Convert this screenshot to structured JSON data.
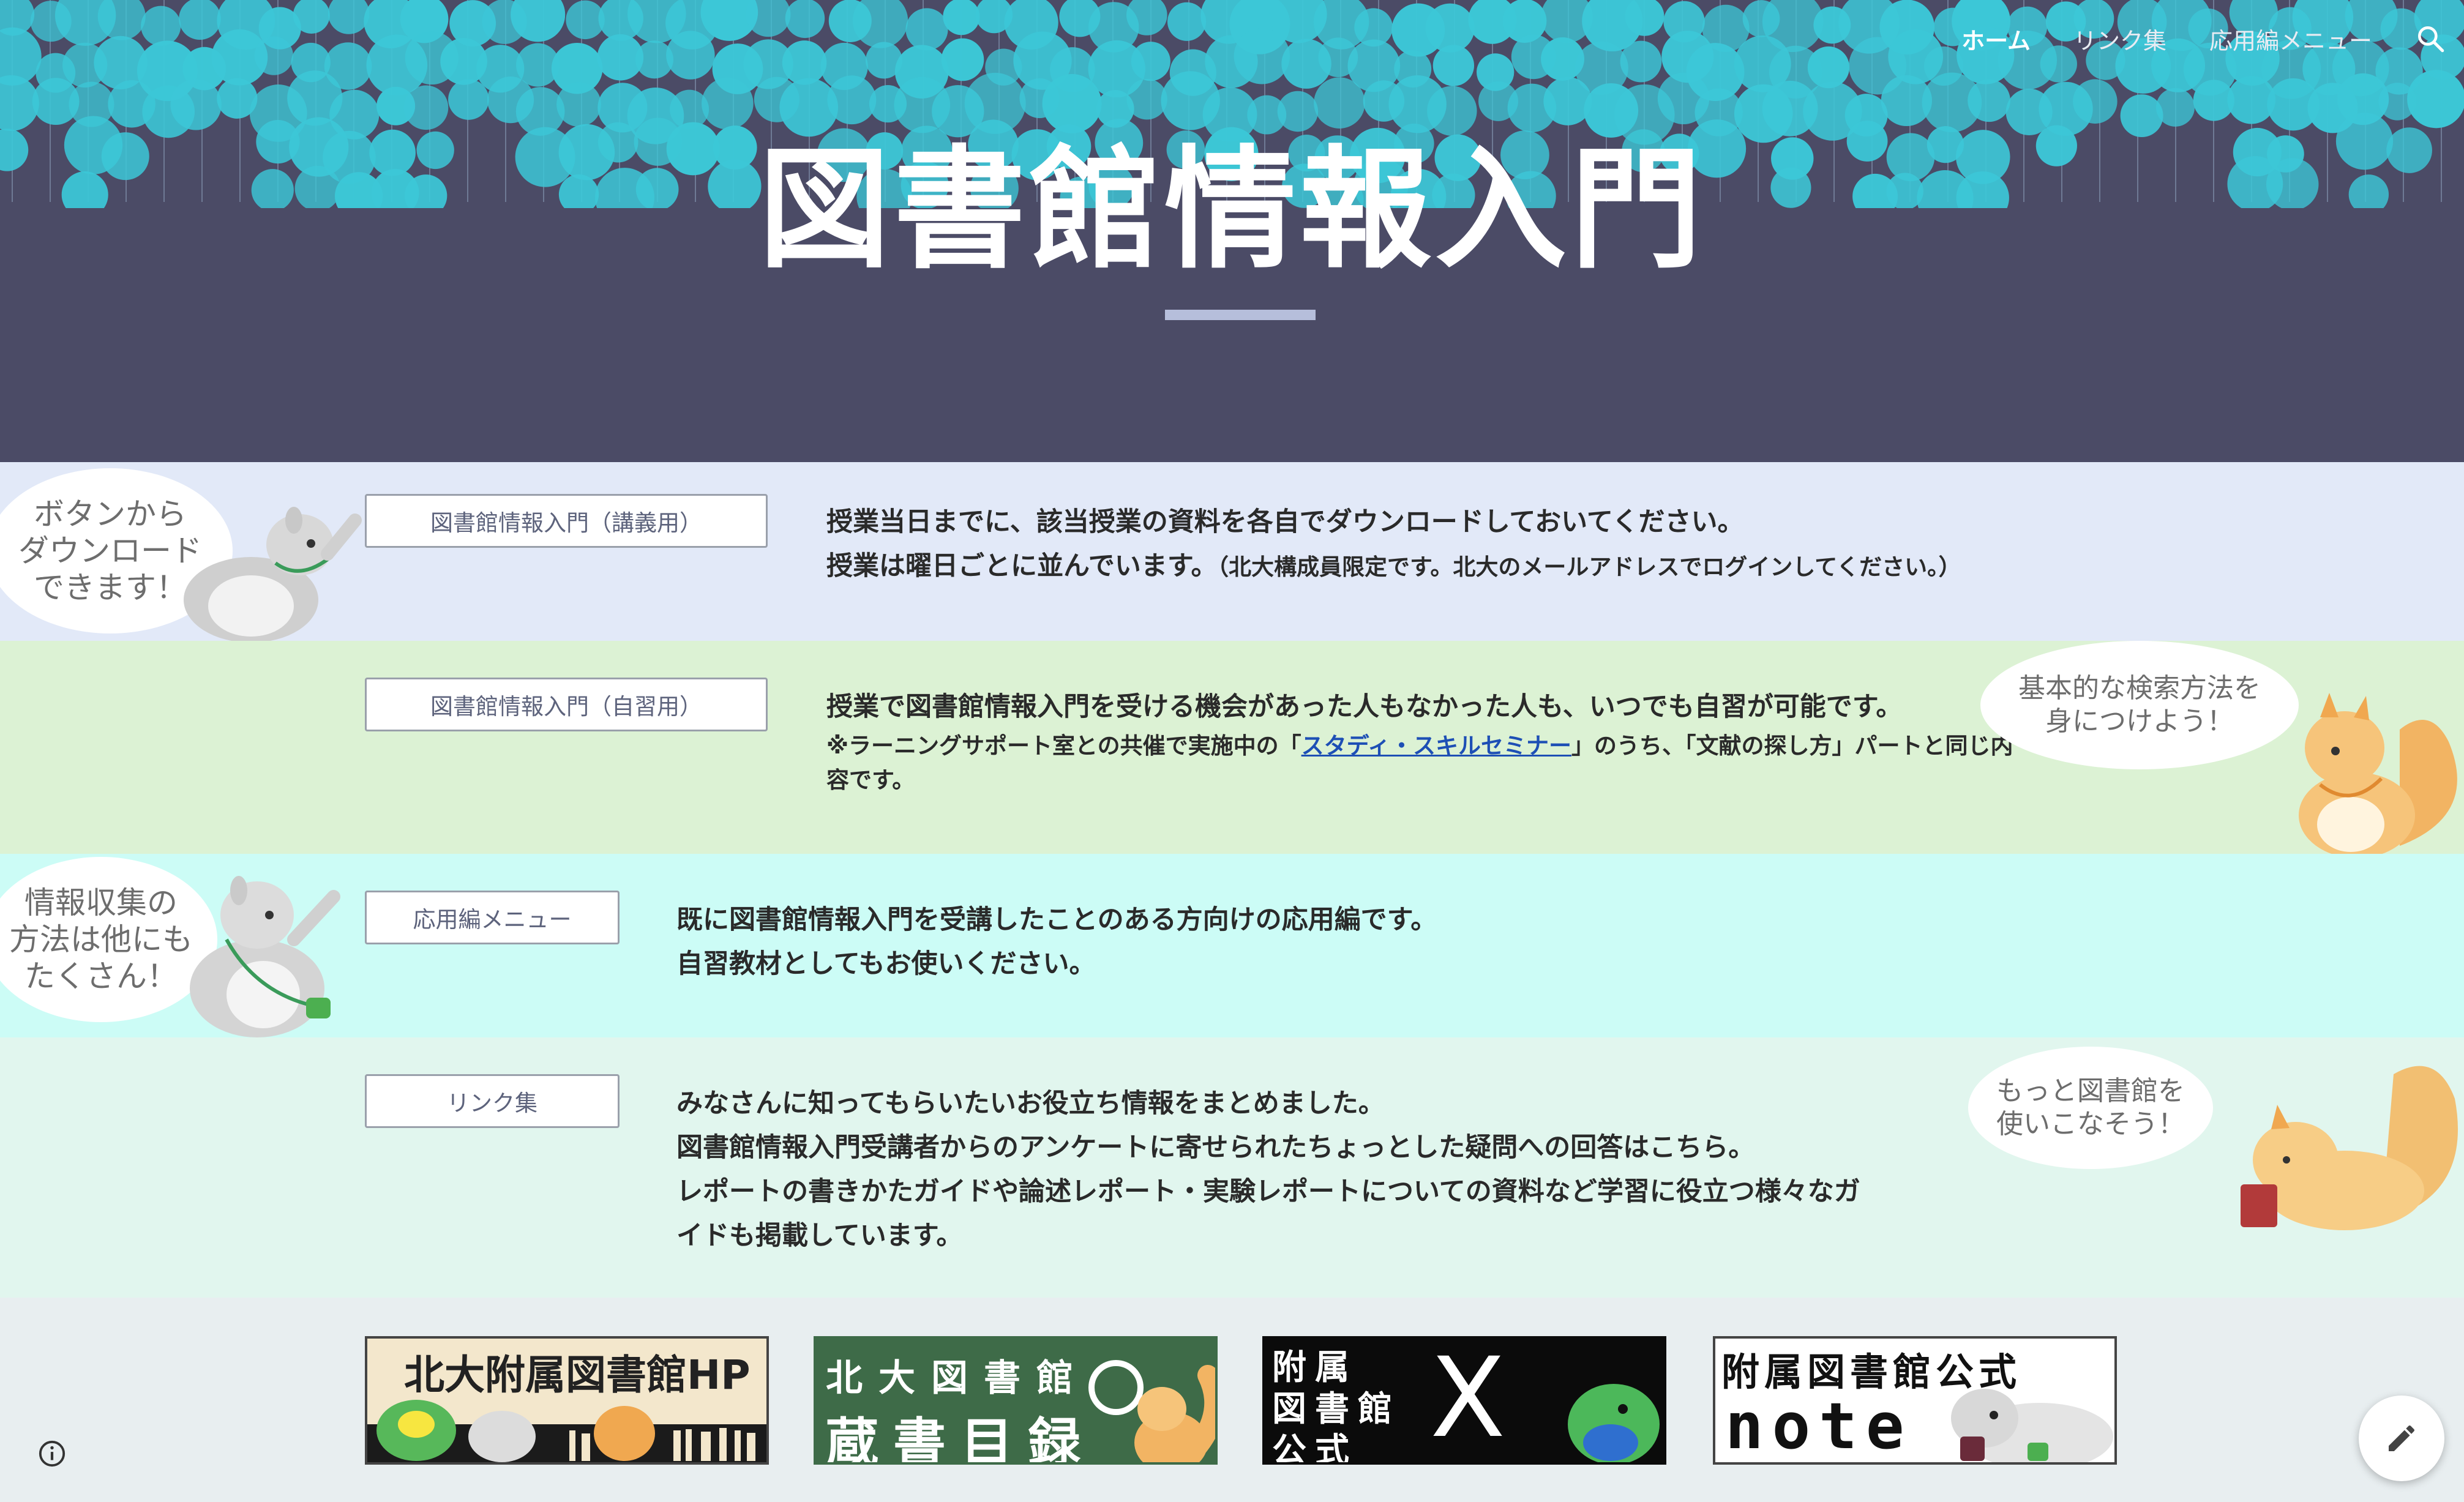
{
  "nav": {
    "items": [
      {
        "label": "ホーム",
        "active": true
      },
      {
        "label": "リンク集",
        "active": false
      },
      {
        "label": "応用編メニュー",
        "active": false
      }
    ],
    "search_icon": "search-icon"
  },
  "hero": {
    "title": "図書館情報入門"
  },
  "sections": {
    "lecture": {
      "button": "図書館情報入門（講義用）",
      "line1": "授業当日までに、該当授業の資料を各自でダウンロードしておいてください。",
      "line2": "授業は曜日ごとに並んでいます。",
      "line2_note": "（北大構成員限定です。北大のメールアドレスでログインしてください。）",
      "bubble": [
        "ボタンから",
        "ダウンロード",
        "できます！"
      ]
    },
    "selfstudy": {
      "button": "図書館情報入門（自習用）",
      "line1": "授業で図書館情報入門を受ける機会があった人もなかった人も、いつでも自習が可能です。",
      "note_pre": "※ラーニングサポート室との共催で実施中の「",
      "note_link": "スタディ・スキルセミナー",
      "note_post": "」のうち、「文献の探し方」パートと同じ内",
      "note_line2": "容です。",
      "bubble": [
        "基本的な検索方法を",
        "身につけよう！"
      ]
    },
    "advanced": {
      "button": "応用編メニュー",
      "line1": "既に図書館情報入門を受講したことのある方向けの応用編です。",
      "line2": "自習教材としてもお使いください。",
      "bubble": [
        "情報収集の",
        "方法は他にも",
        "たくさん！"
      ]
    },
    "links": {
      "button": "リンク集",
      "line1": "みなさんに知ってもらいたいお役立ち情報をまとめました。",
      "line2": "図書館情報入門受講者からのアンケートに寄せられたちょっとした疑問への回答はこちら。",
      "line3": "レポートの書きかたガイドや論述レポート・実験レポートについての資料など学習に役立つ様々なガ",
      "line4": "イドも掲載しています。",
      "bubble": [
        "もっと図書館を",
        "使いこなそう！"
      ]
    }
  },
  "banners": {
    "hp": {
      "text": "北大附属図書館HP",
      "bg": "#f3e7cc"
    },
    "catalog": {
      "line1": "北大図書館",
      "line2": "蔵書目録",
      "bg": "#3e6b48"
    },
    "x": {
      "line1": "附属",
      "line2": "図書館",
      "line3": "公式",
      "logo": "X",
      "bg": "#0b0b0b"
    },
    "note": {
      "line1": "附属図書館公式",
      "logo": "note",
      "bg": "#ffffff"
    }
  },
  "colors": {
    "hero_bg": "#4b4b66",
    "dot": "#3cc7d7",
    "lecture_bg": "#e2e9f8",
    "selfstudy_bg": "#dcf2d4",
    "advanced_bg": "#ccfcf6",
    "links_bg": "#e1f6ee"
  },
  "icons": {
    "info": "info-icon",
    "edit": "pencil-icon"
  }
}
